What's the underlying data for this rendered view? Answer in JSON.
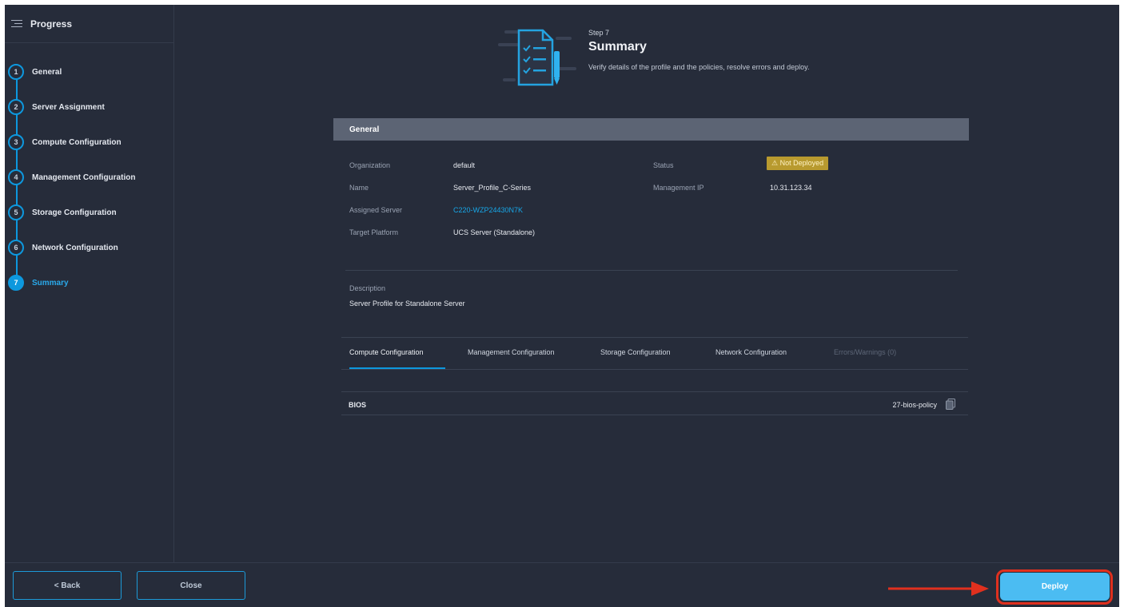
{
  "sidebar": {
    "title": "Progress",
    "steps": [
      {
        "num": "1",
        "label": "General"
      },
      {
        "num": "2",
        "label": "Server Assignment"
      },
      {
        "num": "3",
        "label": "Compute Configuration"
      },
      {
        "num": "4",
        "label": "Management Configuration"
      },
      {
        "num": "5",
        "label": "Storage Configuration"
      },
      {
        "num": "6",
        "label": "Network Configuration"
      },
      {
        "num": "7",
        "label": "Summary"
      }
    ]
  },
  "header": {
    "step_label": "Step 7",
    "title": "Summary",
    "description": "Verify details of the profile and the policies, resolve errors and deploy."
  },
  "general": {
    "section_title": "General",
    "organization_label": "Organization",
    "organization_value": "default",
    "name_label": "Name",
    "name_value": "Server_Profile_C-Series",
    "assigned_server_label": "Assigned Server",
    "assigned_server_value": "C220-WZP24430N7K",
    "target_platform_label": "Target Platform",
    "target_platform_value": "UCS Server (Standalone)",
    "status_label": "Status",
    "status_value": "⚠ Not Deployed",
    "mgmt_ip_label": "Management IP",
    "mgmt_ip_value": "10.31.123.34",
    "description_label": "Description",
    "description_value": "Server Profile for Standalone Server"
  },
  "tabs": [
    {
      "label": "Compute Configuration",
      "state": "active"
    },
    {
      "label": "Management Configuration",
      "state": "normal"
    },
    {
      "label": "Storage Configuration",
      "state": "normal"
    },
    {
      "label": "Network Configuration",
      "state": "normal"
    },
    {
      "label": "Errors/Warnings (0)",
      "state": "disabled"
    }
  ],
  "compute": {
    "row_name": "BIOS",
    "row_policy": "27-bios-policy"
  },
  "footer": {
    "back_label": "<  Back",
    "close_label": "Close",
    "deploy_label": "Deploy"
  },
  "colors": {
    "background": "#262c3a",
    "accent": "#0d98de",
    "primary_button": "#4bbcf2",
    "warning_badge": "#b89a2f",
    "annotation_red": "#e0301e"
  }
}
